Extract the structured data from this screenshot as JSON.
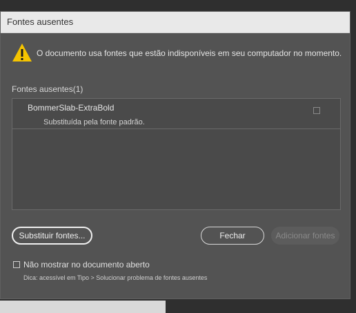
{
  "dialog": {
    "title": "Fontes ausentes",
    "message": "O documento usa fontes que estão indisponíveis em seu computador no momento.",
    "warning_icon": "warning-triangle-icon",
    "section_label": "Fontes ausentes(1)",
    "fonts": [
      {
        "name": "BommerSlab-ExtraBold",
        "substitution": "Substituída pela fonte padrão.",
        "checked": false
      }
    ],
    "buttons": {
      "replace": "Substituir fontes...",
      "close": "Fechar",
      "add": "Adicionar fontes"
    },
    "option": {
      "label": "Não mostrar no documento aberto",
      "checked": false
    },
    "hint": "Dica: acessível em Tipo > Solucionar problema de fontes ausentes"
  },
  "colors": {
    "warning": "#f5c400",
    "dialog_bg": "#535353",
    "titlebar_bg": "#e9e9e9"
  }
}
